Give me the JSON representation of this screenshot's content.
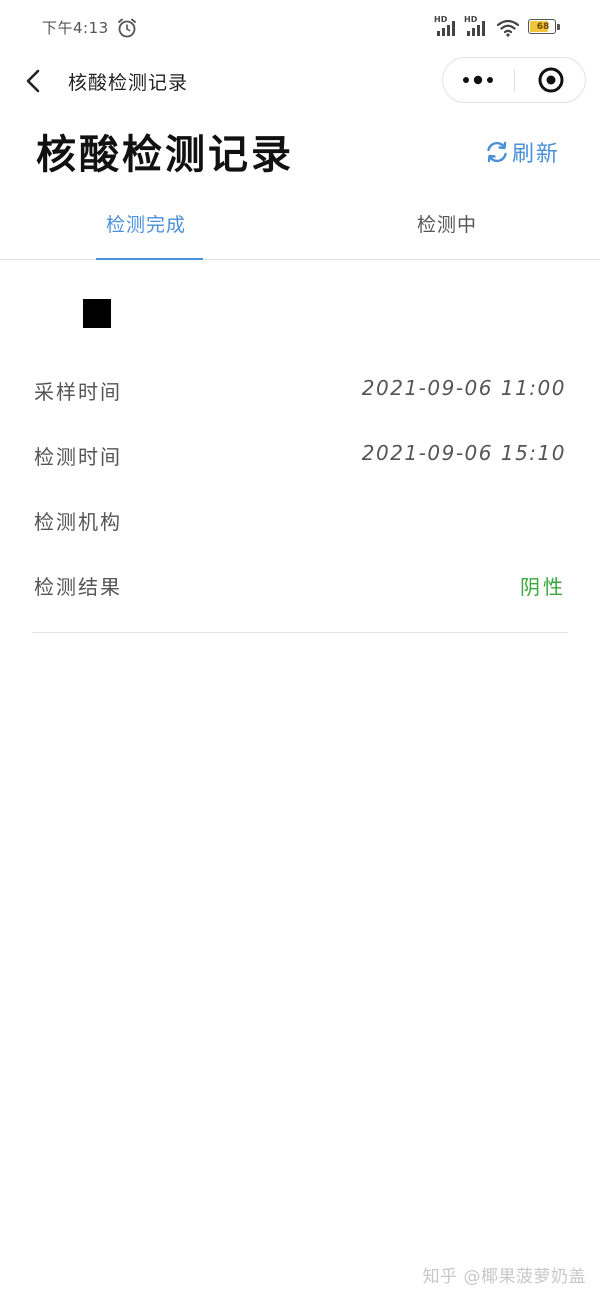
{
  "status_bar": {
    "time": "下午4:13",
    "signal_1_label": "HD",
    "signal_2_label": "HD",
    "battery_level": "68",
    "battery_fraction": 0.68,
    "icons": [
      "alarm-icon",
      "signal-icon",
      "signal-icon",
      "wifi-icon",
      "battery-icon"
    ]
  },
  "nav": {
    "title": "核酸检测记录",
    "icons": [
      "chevron-left-icon",
      "more-dots-icon",
      "target-close-icon"
    ]
  },
  "header": {
    "title": "核酸检测记录",
    "refresh_label": "刷新",
    "refresh_icon": "refresh-icon"
  },
  "tabs": [
    {
      "label": "检测完成",
      "active": true
    },
    {
      "label": "检测中",
      "active": false
    }
  ],
  "record": {
    "fields": [
      {
        "label": "采样时间",
        "value": "2021-09-06 11:00"
      },
      {
        "label": "检测时间",
        "value": "2021-09-06 15:10"
      },
      {
        "label": "检测机构",
        "value": ""
      },
      {
        "label": "检测结果",
        "value": "阴性"
      }
    ]
  },
  "watermark": "知乎 @椰果菠萝奶盖",
  "colors": {
    "accent": "#4a90d9",
    "result_negative": "#3aa73a",
    "text": "#555555",
    "battery": "#f2c53d"
  }
}
